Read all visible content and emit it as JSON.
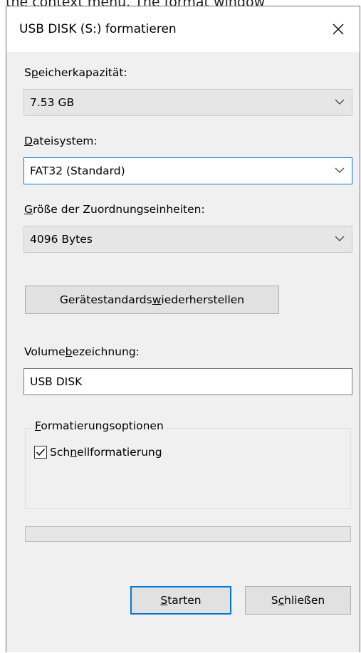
{
  "background_text": "the context menu. The format window",
  "window": {
    "title": "USB DISK (S:) formatieren"
  },
  "capacity": {
    "label_pre": "S",
    "label_ul": "p",
    "label_post": "eicherkapazität:",
    "value": "7.53 GB"
  },
  "filesystem": {
    "label_pre": "",
    "label_ul": "D",
    "label_post": "ateisystem:",
    "value": "FAT32 (Standard)"
  },
  "allocation": {
    "label_pre": "",
    "label_ul": "G",
    "label_post": "röße der Zuordnungseinheiten:",
    "value": "4096 Bytes"
  },
  "restore_button": {
    "label_pre": "Gerätestandards ",
    "label_ul": "w",
    "label_post": "iederherstellen"
  },
  "volume": {
    "label_pre": "Volume",
    "label_ul": "b",
    "label_post": "ezeichnung:",
    "value": "USB DISK"
  },
  "format_options": {
    "legend_pre": "",
    "legend_ul": "F",
    "legend_post": "ormatierungsoptionen",
    "quick_format": {
      "label_pre": "Sch",
      "label_ul": "n",
      "label_post": "ellformatierung",
      "checked": true
    }
  },
  "progress": {
    "value": 0
  },
  "buttons": {
    "start": {
      "label_pre": "",
      "label_ul": "S",
      "label_post": "tarten"
    },
    "close": {
      "label_pre": "S",
      "label_ul": "c",
      "label_post": "hließen"
    }
  },
  "colors": {
    "accent": "#0078d7",
    "dialog_bg": "#f0f0f0",
    "titlebar_bg": "#ffffff"
  },
  "icons": [
    "close-icon",
    "chevron-down-icon",
    "checkmark-icon"
  ]
}
